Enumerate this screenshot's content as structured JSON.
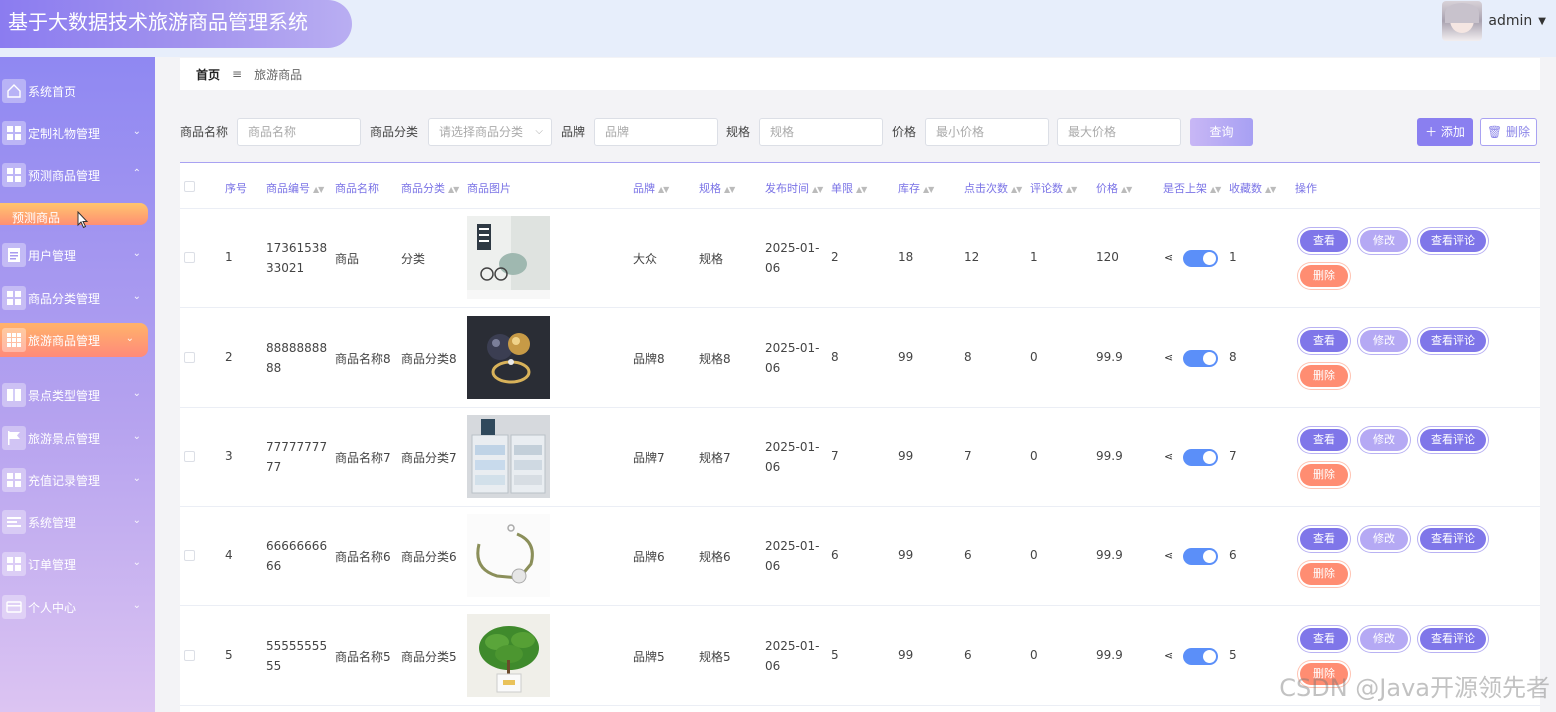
{
  "header": {
    "title": "基于大数据技术旅游商品管理系统",
    "username": "admin"
  },
  "sidebar": {
    "items": [
      {
        "label": "系统首页",
        "icon": "home-icon"
      },
      {
        "label": "定制礼物管理",
        "icon": "grid-icon"
      },
      {
        "label": "预测商品管理",
        "icon": "grid-icon"
      },
      {
        "label": "用户管理",
        "icon": "document-icon"
      },
      {
        "label": "商品分类管理",
        "icon": "grid-icon"
      },
      {
        "label": "旅游商品管理",
        "icon": "apps-icon"
      },
      {
        "label": "景点类型管理",
        "icon": "book-icon"
      },
      {
        "label": "旅游景点管理",
        "icon": "flag-icon"
      },
      {
        "label": "充值记录管理",
        "icon": "grid-icon"
      },
      {
        "label": "系统管理",
        "icon": "list-icon"
      },
      {
        "label": "订单管理",
        "icon": "grid-icon"
      },
      {
        "label": "个人中心",
        "icon": "card-icon"
      }
    ],
    "subitem": "预测商品"
  },
  "breadcrumb": {
    "home": "首页",
    "current": "旅游商品"
  },
  "search": {
    "name_label": "商品名称",
    "name_placeholder": "商品名称",
    "category_label": "商品分类",
    "category_placeholder": "请选择商品分类",
    "brand_label": "品牌",
    "brand_placeholder": "品牌",
    "spec_label": "规格",
    "spec_placeholder": "规格",
    "price_label": "价格",
    "min_price_placeholder": "最小价格",
    "max_price_placeholder": "最大价格",
    "query_label": "查询",
    "add_label": "添加",
    "delete_label": "删除"
  },
  "table": {
    "headers": {
      "index": "序号",
      "code": "商品编号",
      "name": "商品名称",
      "category": "商品分类",
      "image": "商品图片",
      "brand": "品牌",
      "spec": "规格",
      "publish": "发布时间",
      "limit": "单限",
      "stock": "库存",
      "clicks": "点击次数",
      "comments": "评论数",
      "price": "价格",
      "on_sale": "是否上架",
      "favorites": "收藏数",
      "ops": "操作"
    },
    "actions": {
      "view": "查看",
      "edit": "修改",
      "comment": "查看评论",
      "delete": "删除"
    },
    "rows": [
      {
        "index": "1",
        "code": "1736153833021",
        "name": "商品",
        "category": "分类",
        "brand": "大众",
        "spec": "规格",
        "publish": "2025-01-06",
        "limit": "2",
        "stock": "18",
        "clicks": "12",
        "comments": "1",
        "price": "120",
        "on_sale": true,
        "favorites": "1",
        "image": "glasses-display-photo"
      },
      {
        "index": "2",
        "code": "8888888888",
        "name": "商品名称8",
        "category": "商品分类8",
        "brand": "品牌8",
        "spec": "规格8",
        "publish": "2025-01-06",
        "limit": "8",
        "stock": "99",
        "clicks": "8",
        "comments": "0",
        "price": "99.9",
        "on_sale": true,
        "favorites": "8",
        "image": "pearl-ring-photo"
      },
      {
        "index": "3",
        "code": "7777777777",
        "name": "商品名称7",
        "category": "商品分类7",
        "brand": "品牌7",
        "spec": "规格7",
        "publish": "2025-01-06",
        "limit": "7",
        "stock": "99",
        "clicks": "7",
        "comments": "0",
        "price": "99.9",
        "on_sale": true,
        "favorites": "7",
        "image": "storage-drawers-photo"
      },
      {
        "index": "4",
        "code": "6666666666",
        "name": "商品名称6",
        "category": "商品分类6",
        "brand": "品牌6",
        "spec": "规格6",
        "publish": "2025-01-06",
        "limit": "6",
        "stock": "99",
        "clicks": "6",
        "comments": "0",
        "price": "99.9",
        "on_sale": true,
        "favorites": "6",
        "image": "bracelet-photo"
      },
      {
        "index": "5",
        "code": "5555555555",
        "name": "商品名称5",
        "category": "商品分类5",
        "brand": "品牌5",
        "spec": "规格5",
        "publish": "2025-01-06",
        "limit": "5",
        "stock": "99",
        "clicks": "6",
        "comments": "0",
        "price": "99.9",
        "on_sale": true,
        "favorites": "5",
        "image": "potted-plant-photo"
      }
    ]
  },
  "watermark": "CSDN @Java开源领先者",
  "colors": {
    "accent": "#7f76e9",
    "danger": "#ff8d72",
    "active_nav": "#ffa06f"
  }
}
